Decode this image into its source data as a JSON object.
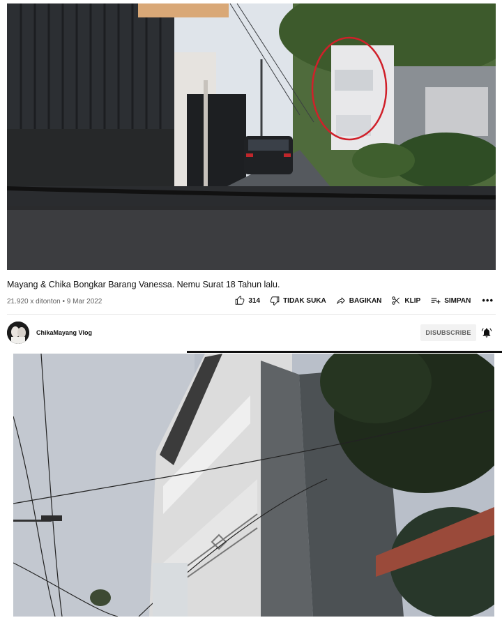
{
  "video": {
    "title": "Mayang & Chika Bongkar Barang Vanessa. Nemu Surat 18 Tahun lalu.",
    "meta": "21.920 x ditonton • 9 Mar 2022"
  },
  "actions": {
    "like_count": "314",
    "dislike_label": "TIDAK SUKA",
    "share_label": "BAGIKAN",
    "clip_label": "KLIP",
    "save_label": "SIMPAN",
    "more_label": "•••"
  },
  "channel": {
    "name": "ChikaMayang Vlog",
    "subscribe_label": "DISUBSCRIBE"
  },
  "colors": {
    "annotation_circle": "#d0202a",
    "button_bg": "#f2f2f2",
    "meta_text": "#606060"
  },
  "icons": [
    "thumbs-up-icon",
    "thumbs-down-icon",
    "share-icon",
    "scissors-icon",
    "playlist-add-icon",
    "bell-icon"
  ]
}
